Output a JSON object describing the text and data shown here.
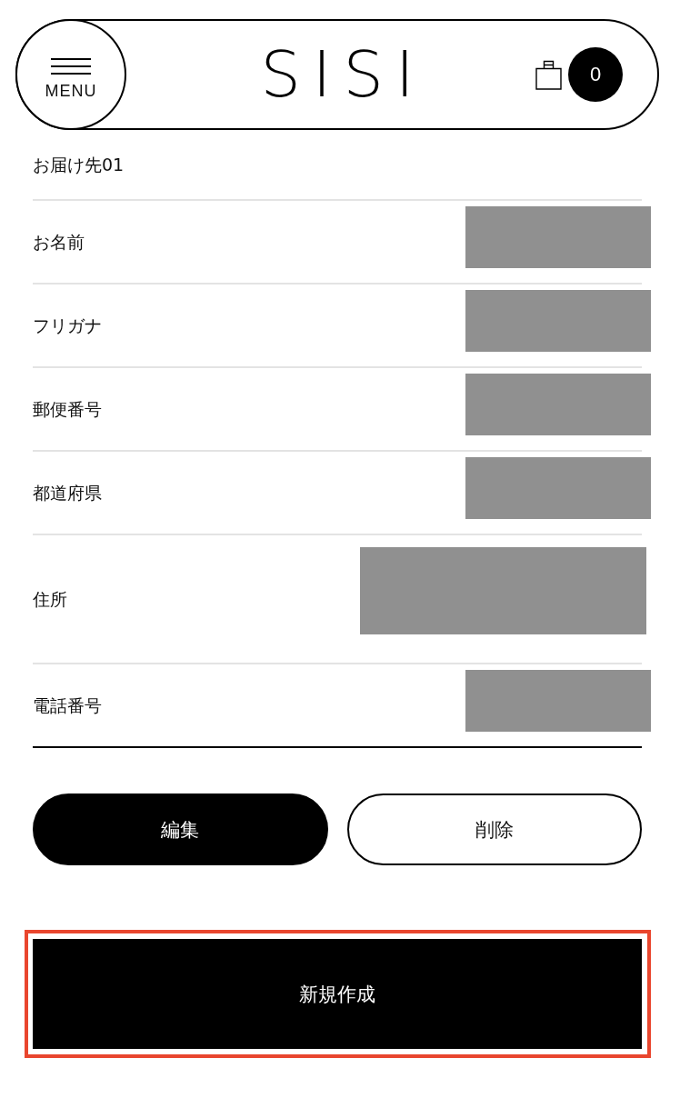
{
  "header": {
    "menu_label": "MENU",
    "logo": "SISI",
    "cart_count": "0"
  },
  "address": {
    "title": "お届け先01",
    "rows": [
      {
        "label": "お名前",
        "kind": "single_line"
      },
      {
        "label": "フリガナ",
        "kind": "single_line"
      },
      {
        "label": "郵便番号",
        "kind": "single_line"
      },
      {
        "label": "都道府県",
        "kind": "single_line"
      },
      {
        "label": "住所",
        "kind": "multi_line"
      },
      {
        "label": "電話番号",
        "kind": "single_line"
      }
    ]
  },
  "actions": [
    {
      "label": "編集",
      "kind": "primary"
    },
    {
      "label": "削除",
      "kind": "outline"
    }
  ],
  "new_button": {
    "label": "新規作成",
    "highlighted": true
  }
}
